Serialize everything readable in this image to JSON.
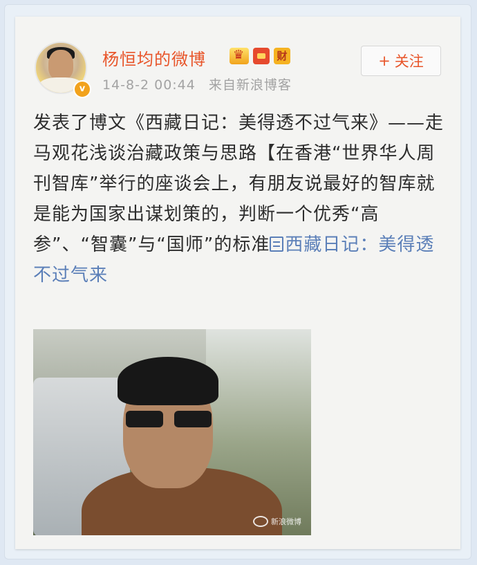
{
  "user": {
    "name": "杨恒均的微博",
    "verified_badge": "v",
    "badges": [
      "crown-badge-icon",
      "red-envelope-icon",
      "cai-badge-icon"
    ],
    "cai_badge_text": "财"
  },
  "meta": {
    "timestamp": "14-8-2 00:44",
    "source": "来自新浪博客"
  },
  "follow": {
    "icon": "plus-icon",
    "plus_symbol": "+",
    "label": "关注"
  },
  "post": {
    "text": "发表了博文《西藏日记：美得透不过气来》——走马观花浅谈治藏政策与思路【在香港“世界华人周刊智库”举行的座谈会上，有朋友说最好的智库就是能为国家出谋划策的，判断一个优秀“高参”、“智囊”与“国师”的标准",
    "link_icon": "article-link-icon",
    "link_text": "西藏日记：美得透不过气来"
  },
  "photo": {
    "watermark": "新浪微博"
  },
  "colors": {
    "accent": "#e8552a",
    "link": "#5b7fb8",
    "meta": "#a3a3a3",
    "text": "#2d2d2d"
  }
}
